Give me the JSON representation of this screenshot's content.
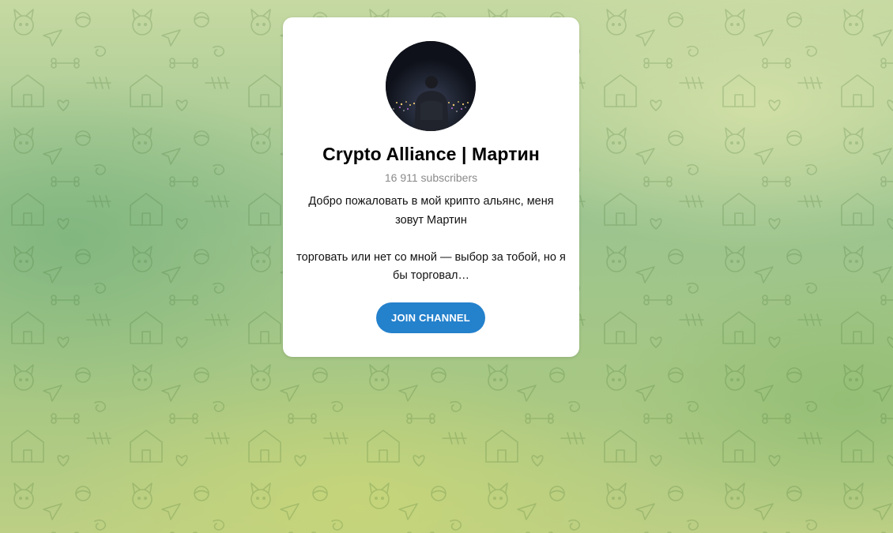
{
  "channel": {
    "title": "Crypto Alliance | Мартин",
    "subscribers": "16 911 subscribers",
    "description": [
      "Добро пожаловать в мой крипто альянс, меня зовут Мартин",
      "торговать или нет со мной — выбор за тобой, но я бы торговал…"
    ],
    "join_label": "JOIN CHANNEL",
    "avatar_icon": "person-city-night-photo"
  },
  "colors": {
    "accent": "#2481cc",
    "card_background": "#ffffff",
    "muted_text": "#8a8a8a"
  },
  "background_icon": "doodle-pattern"
}
